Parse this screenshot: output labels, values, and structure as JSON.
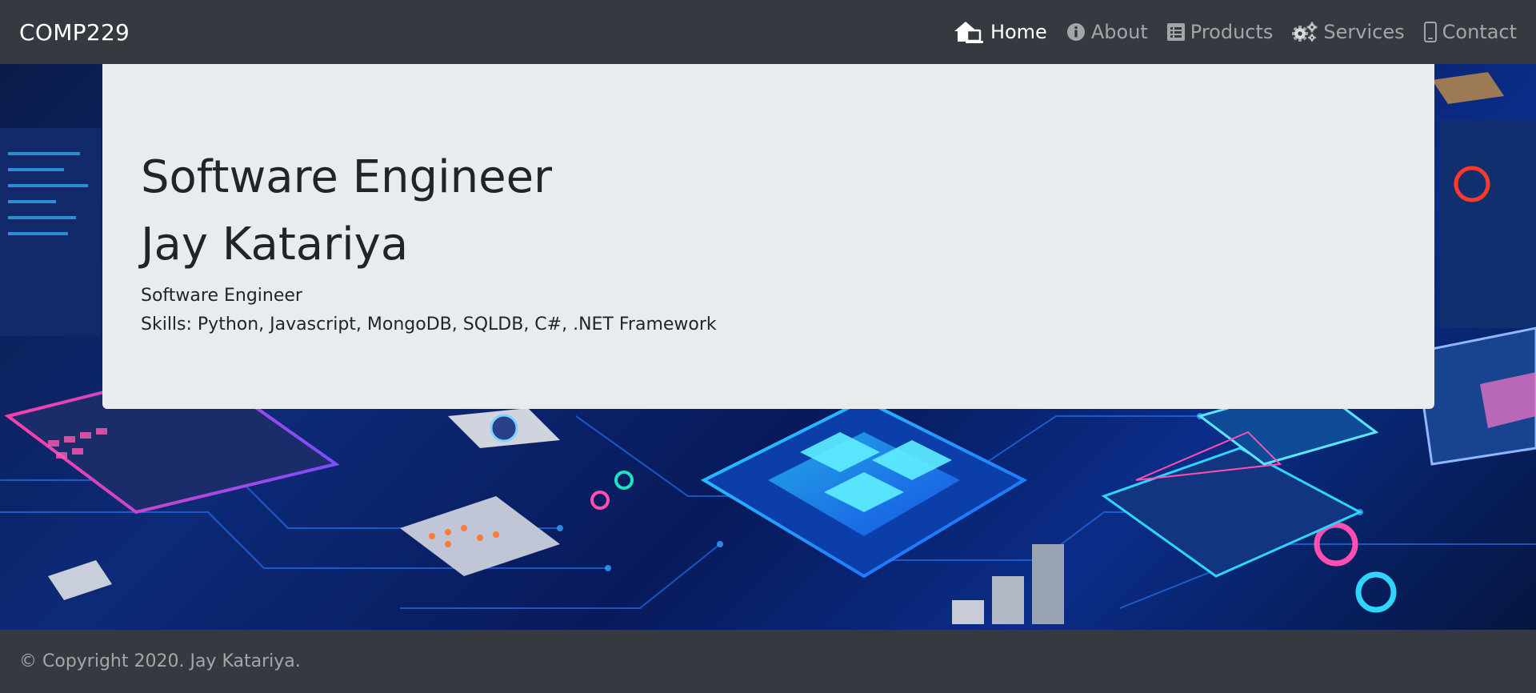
{
  "nav": {
    "brand": "COMP229",
    "items": [
      {
        "label": "Home",
        "icon": "home-icon",
        "active": true
      },
      {
        "label": "About",
        "icon": "info-icon",
        "active": false
      },
      {
        "label": "Products",
        "icon": "list-icon",
        "active": false
      },
      {
        "label": "Services",
        "icon": "gears-icon",
        "active": false
      },
      {
        "label": "Contact",
        "icon": "phone-icon",
        "active": false
      }
    ]
  },
  "jumbotron": {
    "title_line1": "Software Engineer",
    "title_line2": "Jay Katariya",
    "role": "Software Engineer",
    "skills": "Skills: Python, Javascript, MongoDB, SQLDB, C#, .NET Framework"
  },
  "footer": {
    "copyright": "© Copyright 2020. Jay Katariya."
  },
  "colors": {
    "navbar_bg": "#343a40",
    "jumbotron_bg": "#e9ecef",
    "text_dark": "#212529",
    "nav_muted": "rgba(255,255,255,0.55)"
  }
}
